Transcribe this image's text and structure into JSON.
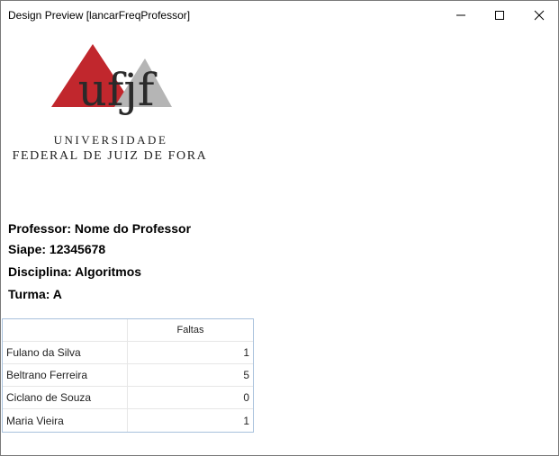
{
  "window": {
    "title": "Design Preview [lancarFreqProfessor]",
    "controls": [
      "minimize-icon",
      "maximize-icon",
      "close-icon"
    ]
  },
  "logo": {
    "mark": "ufjf",
    "line1": "UNIVERSIDADE",
    "line2": "FEDERAL DE JUIZ DE FORA",
    "colors": {
      "red": "#c1272d",
      "gray": "#b5b5b5",
      "text": "#222222"
    }
  },
  "info": {
    "professor": "Professor: Nome do Professor",
    "siape": "Siape: 12345678",
    "disciplina": "Disciplina: Algoritmos",
    "turma": "Turma: A"
  },
  "table": {
    "headers": [
      "",
      "Faltas"
    ],
    "rows": [
      {
        "name": "Fulano da Silva",
        "faltas": "1"
      },
      {
        "name": "Beltrano Ferreira",
        "faltas": "5"
      },
      {
        "name": "Ciclano de Souza",
        "faltas": "0"
      },
      {
        "name": "Maria Vieira",
        "faltas": "1"
      }
    ]
  }
}
